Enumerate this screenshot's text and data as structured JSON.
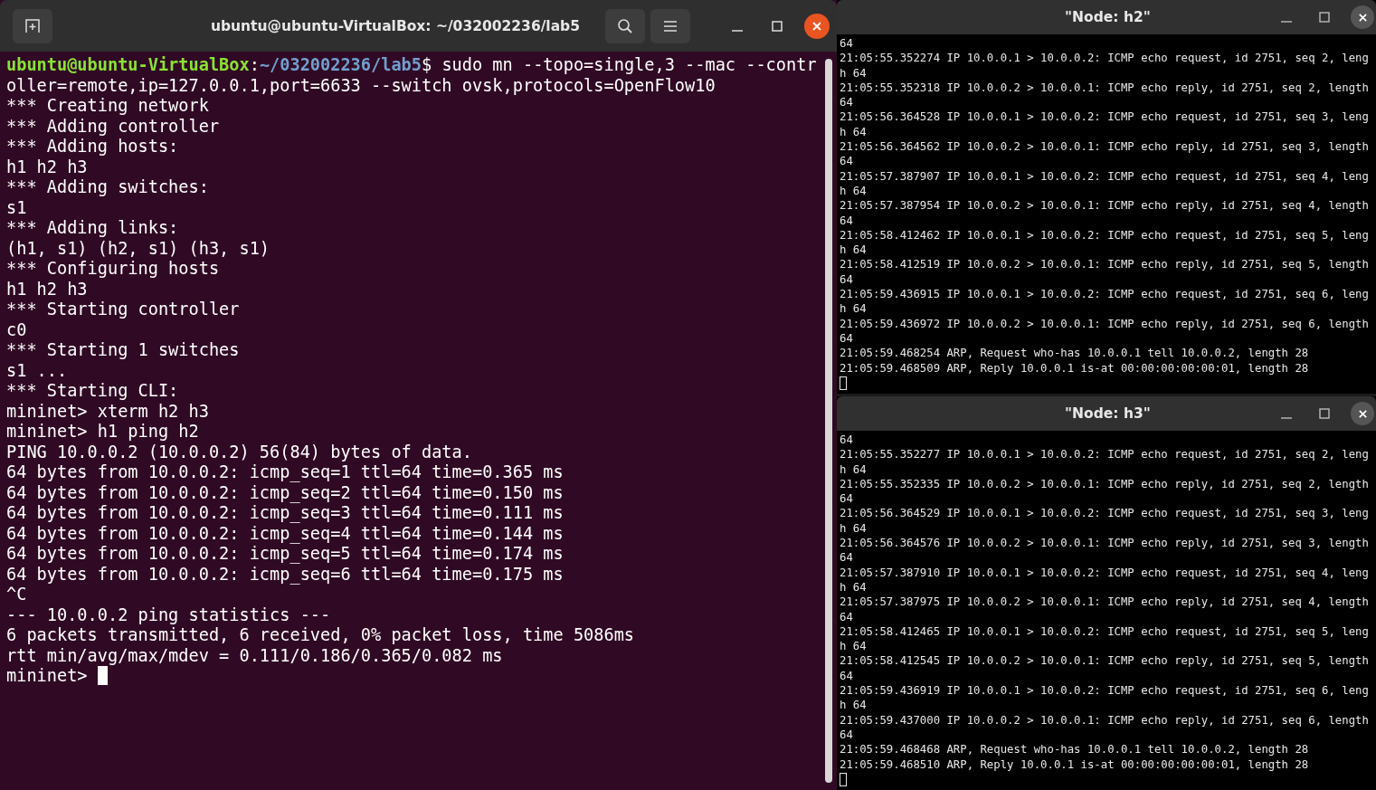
{
  "terminal": {
    "title": "ubuntu@ubuntu-VirtualBox: ~/032002236/lab5",
    "prompt": {
      "user": "ubuntu@ubuntu-VirtualBox",
      "separator": ":",
      "path": "~/032002236/lab5",
      "command": "$ sudo mn --topo=single,3 --mac --contr"
    },
    "lines": [
      "oller=remote,ip=127.0.0.1,port=6633 --switch ovsk,protocols=OpenFlow10",
      "*** Creating network",
      "*** Adding controller",
      "*** Adding hosts:",
      "h1 h2 h3",
      "*** Adding switches:",
      "s1",
      "*** Adding links:",
      "(h1, s1) (h2, s1) (h3, s1)",
      "*** Configuring hosts",
      "h1 h2 h3",
      "*** Starting controller",
      "c0",
      "*** Starting 1 switches",
      "s1 ...",
      "*** Starting CLI:",
      "mininet> xterm h2 h3",
      "mininet> h1 ping h2",
      "PING 10.0.0.2 (10.0.0.2) 56(84) bytes of data.",
      "64 bytes from 10.0.0.2: icmp_seq=1 ttl=64 time=0.365 ms",
      "64 bytes from 10.0.0.2: icmp_seq=2 ttl=64 time=0.150 ms",
      "64 bytes from 10.0.0.2: icmp_seq=3 ttl=64 time=0.111 ms",
      "64 bytes from 10.0.0.2: icmp_seq=4 ttl=64 time=0.144 ms",
      "64 bytes from 10.0.0.2: icmp_seq=5 ttl=64 time=0.174 ms",
      "64 bytes from 10.0.0.2: icmp_seq=6 ttl=64 time=0.175 ms",
      "^C",
      "--- 10.0.0.2 ping statistics ---",
      "6 packets transmitted, 6 received, 0% packet loss, time 5086ms",
      "rtt min/avg/max/mdev = 0.111/0.186/0.365/0.082 ms"
    ],
    "input_prompt": "mininet>"
  },
  "xterms": [
    {
      "title": "\"Node: h2\"",
      "lines": [
        "64",
        "21:05:55.352274 IP 10.0.0.1 > 10.0.0.2: ICMP echo request, id 2751, seq 2, leng",
        "h 64",
        "21:05:55.352318 IP 10.0.0.2 > 10.0.0.1: ICMP echo reply, id 2751, seq 2, length",
        "64",
        "21:05:56.364528 IP 10.0.0.1 > 10.0.0.2: ICMP echo request, id 2751, seq 3, leng",
        "h 64",
        "21:05:56.364562 IP 10.0.0.2 > 10.0.0.1: ICMP echo reply, id 2751, seq 3, length",
        "64",
        "21:05:57.387907 IP 10.0.0.1 > 10.0.0.2: ICMP echo request, id 2751, seq 4, leng",
        "h 64",
        "21:05:57.387954 IP 10.0.0.2 > 10.0.0.1: ICMP echo reply, id 2751, seq 4, length",
        "64",
        "21:05:58.412462 IP 10.0.0.1 > 10.0.0.2: ICMP echo request, id 2751, seq 5, leng",
        "h 64",
        "21:05:58.412519 IP 10.0.0.2 > 10.0.0.1: ICMP echo reply, id 2751, seq 5, length",
        "64",
        "21:05:59.436915 IP 10.0.0.1 > 10.0.0.2: ICMP echo request, id 2751, seq 6, leng",
        "h 64",
        "21:05:59.436972 IP 10.0.0.2 > 10.0.0.1: ICMP echo reply, id 2751, seq 6, length",
        "64",
        "21:05:59.468254 ARP, Request who-has 10.0.0.1 tell 10.0.0.2, length 28",
        "21:05:59.468509 ARP, Reply 10.0.0.1 is-at 00:00:00:00:00:01, length 28"
      ]
    },
    {
      "title": "\"Node: h3\"",
      "lines": [
        "64",
        "21:05:55.352277 IP 10.0.0.1 > 10.0.0.2: ICMP echo request, id 2751, seq 2, leng",
        "h 64",
        "21:05:55.352335 IP 10.0.0.2 > 10.0.0.1: ICMP echo reply, id 2751, seq 2, length",
        "64",
        "21:05:56.364529 IP 10.0.0.1 > 10.0.0.2: ICMP echo request, id 2751, seq 3, leng",
        "h 64",
        "21:05:56.364576 IP 10.0.0.2 > 10.0.0.1: ICMP echo reply, id 2751, seq 3, length",
        "64",
        "21:05:57.387910 IP 10.0.0.1 > 10.0.0.2: ICMP echo request, id 2751, seq 4, leng",
        "h 64",
        "21:05:57.387975 IP 10.0.0.2 > 10.0.0.1: ICMP echo reply, id 2751, seq 4, length",
        "64",
        "21:05:58.412465 IP 10.0.0.1 > 10.0.0.2: ICMP echo request, id 2751, seq 5, leng",
        "h 64",
        "21:05:58.412545 IP 10.0.0.2 > 10.0.0.1: ICMP echo reply, id 2751, seq 5, length",
        "64",
        "21:05:59.436919 IP 10.0.0.1 > 10.0.0.2: ICMP echo request, id 2751, seq 6, leng",
        "h 64",
        "21:05:59.437000 IP 10.0.0.2 > 10.0.0.1: ICMP echo reply, id 2751, seq 6, length",
        "64",
        "21:05:59.468468 ARP, Request who-has 10.0.0.1 tell 10.0.0.2, length 28",
        "21:05:59.468510 ARP, Reply 10.0.0.1 is-at 00:00:00:00:00:01, length 28"
      ]
    }
  ]
}
